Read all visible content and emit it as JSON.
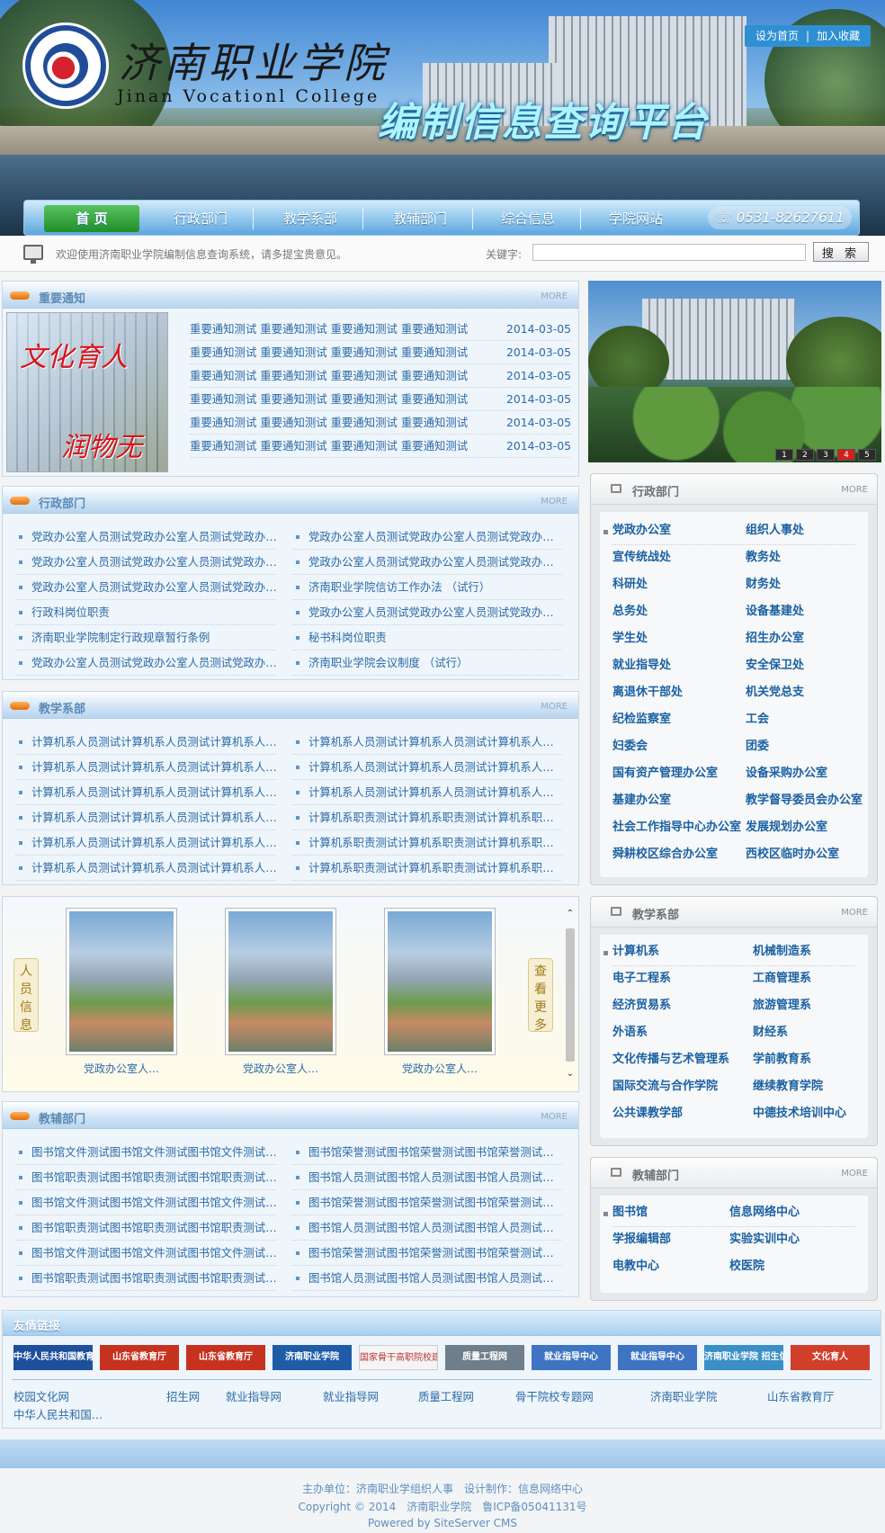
{
  "header": {
    "school_name_cn": "济南职业学院",
    "school_name_en": "Jinan Vocationl College",
    "platform_title": "编制信息查询平台",
    "set_homepage": "设为首页",
    "add_favorite": "加入收藏",
    "separator": "|"
  },
  "nav": {
    "items": [
      "首 页",
      "行政部门",
      "教学系部",
      "教辅部门",
      "综合信息",
      "学院网站"
    ],
    "phone": "0531-82627611"
  },
  "welcome": {
    "text": "欢迎使用济南职业学院编制信息查询系统，请多提宝贵意见。",
    "keyword_label": "关键字:",
    "search_value": "",
    "search_button": "搜 索"
  },
  "more_label": "MORE",
  "notice": {
    "title": "重要通知",
    "image_text_1": "文化育人",
    "image_text_2": "润物无声",
    "items": [
      {
        "text": "重要通知测试 重要通知测试 重要通知测试 重要通知测试",
        "date": "2014-03-05"
      },
      {
        "text": "重要通知测试 重要通知测试 重要通知测试 重要通知测试",
        "date": "2014-03-05"
      },
      {
        "text": "重要通知测试 重要通知测试 重要通知测试 重要通知测试",
        "date": "2014-03-05"
      },
      {
        "text": "重要通知测试 重要通知测试 重要通知测试 重要通知测试",
        "date": "2014-03-05"
      },
      {
        "text": "重要通知测试 重要通知测试 重要通知测试 重要通知测试",
        "date": "2014-03-05"
      },
      {
        "text": "重要通知测试 重要通知测试 重要通知测试 重要通知测试",
        "date": "2014-03-05"
      }
    ]
  },
  "admin": {
    "title": "行政部门",
    "items": [
      "党政办公室人员测试党政办公室人员测试党政办…",
      "党政办公室人员测试党政办公室人员测试党政办…",
      "党政办公室人员测试党政办公室人员测试党政办…",
      "党政办公室人员测试党政办公室人员测试党政办…",
      "党政办公室人员测试党政办公室人员测试党政办…",
      "济南职业学院信访工作办法 （试行）",
      "行政科岗位职责",
      "党政办公室人员测试党政办公室人员测试党政办…",
      "济南职业学院制定行政规章暂行条例",
      "秘书科岗位职责",
      "党政办公室人员测试党政办公室人员测试党政办…",
      "济南职业学院会议制度 （试行）"
    ]
  },
  "teaching": {
    "title": "教学系部",
    "items": [
      "计算机系人员测试计算机系人员测试计算机系人…",
      "计算机系人员测试计算机系人员测试计算机系人…",
      "计算机系人员测试计算机系人员测试计算机系人…",
      "计算机系人员测试计算机系人员测试计算机系人…",
      "计算机系人员测试计算机系人员测试计算机系人…",
      "计算机系人员测试计算机系人员测试计算机系人…",
      "计算机系人员测试计算机系人员测试计算机系人…",
      "计算机系职责测试计算机系职责测试计算机系职…",
      "计算机系人员测试计算机系人员测试计算机系人…",
      "计算机系职责测试计算机系职责测试计算机系职…",
      "计算机系人员测试计算机系人员测试计算机系人…",
      "计算机系职责测试计算机系职责测试计算机系职…"
    ]
  },
  "staff": {
    "left_tag": "人员信息",
    "right_tag": "查看更多",
    "photos": [
      "党政办公室人…",
      "党政办公室人…",
      "党政办公室人…"
    ]
  },
  "support": {
    "title": "教辅部门",
    "items": [
      "图书馆文件测试图书馆文件测试图书馆文件测试…",
      "图书馆荣誉测试图书馆荣誉测试图书馆荣誉测试…",
      "图书馆职责测试图书馆职责测试图书馆职责测试…",
      "图书馆人员测试图书馆人员测试图书馆人员测试…",
      "图书馆文件测试图书馆文件测试图书馆文件测试…",
      "图书馆荣誉测试图书馆荣誉测试图书馆荣誉测试…",
      "图书馆职责测试图书馆职责测试图书馆职责测试…",
      "图书馆人员测试图书馆人员测试图书馆人员测试…",
      "图书馆文件测试图书馆文件测试图书馆文件测试…",
      "图书馆荣誉测试图书馆荣誉测试图书馆荣誉测试…",
      "图书馆职责测试图书馆职责测试图书馆职责测试…",
      "图书馆人员测试图书馆人员测试图书馆人员测试…"
    ]
  },
  "slideshow": {
    "pages": [
      "1",
      "2",
      "3",
      "4",
      "5"
    ],
    "active_page": "4"
  },
  "right_admin": {
    "title": "行政部门",
    "items": [
      "党政办公室",
      "组织人事处",
      "宣传统战处",
      "教务处",
      "科研处",
      "财务处",
      "总务处",
      "设备基建处",
      "学生处",
      "招生办公室",
      "就业指导处",
      "安全保卫处",
      "离退休干部处",
      "机关党总支",
      "纪检监察室",
      "工会",
      "妇委会",
      "团委",
      "国有资产管理办公室",
      "设备采购办公室",
      "基建办公室",
      "教学督导委员会办公室",
      "社会工作指导中心办公室",
      "发展规划办公室",
      "舜耕校区综合办公室",
      "西校区临时办公室"
    ]
  },
  "right_teaching": {
    "title": "教学系部",
    "items": [
      "计算机系",
      "机械制造系",
      "电子工程系",
      "工商管理系",
      "经济贸易系",
      "旅游管理系",
      "外语系",
      "财经系",
      "文化传播与艺术管理系",
      "学前教育系",
      "国际交流与合作学院",
      "继续教育学院",
      "公共课教学部",
      "中德技术培训中心"
    ]
  },
  "right_support": {
    "title": "教辅部门",
    "items": [
      "图书馆",
      "信息网络中心",
      "学报编辑部",
      "实验实训中心",
      "电教中心",
      "校医院"
    ]
  },
  "links": {
    "title": "友情链接",
    "banners": [
      "中华人民共和国教育部",
      "山东省教育厅",
      "山东省教育厅",
      "济南职业学院",
      "国家骨干高职院校建设专题",
      "质量工程网",
      "就业指导中心",
      "就业指导中心",
      "济南职业学院 招生信息网",
      "文化育人"
    ],
    "banner_colors": [
      "#1d4f9c",
      "#c7321e",
      "#c7321e",
      "#1f5ca8",
      "#f4f4f4",
      "#6f7e8c",
      "#3f74c2",
      "#3f74c2",
      "#3a8fc7",
      "#d13f2b"
    ],
    "text_links": [
      "校园文化网",
      "招生网",
      "就业指导网",
      "就业指导网",
      "质量工程网",
      "骨干院校专题网",
      "济南职业学院",
      "山东省教育厅",
      "中华人民共和国…"
    ]
  },
  "footer": {
    "line1": "主办单位：济南职业学组织人事　设计制作：信息网络中心",
    "line2": "Copyright © 2014　济南职业学院　鲁ICP备05041131号",
    "line3": "Powered by SiteServer CMS"
  }
}
